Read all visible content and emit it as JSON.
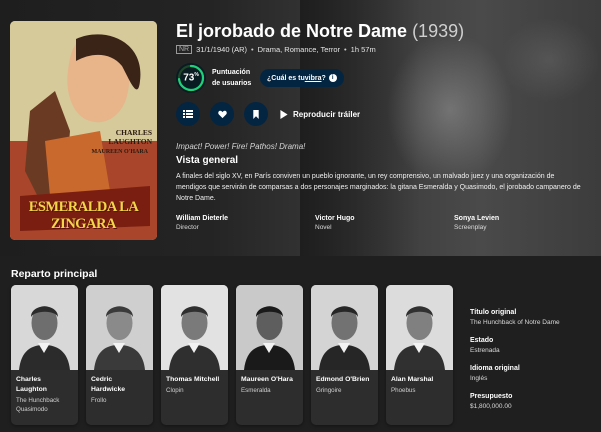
{
  "movie": {
    "title": "El jorobado de Notre Dame",
    "year": "(1939)",
    "certification": "NR",
    "release": "31/1/1940 (AR)",
    "genres": "Drama, Romance, Terror",
    "runtime": "1h 57m",
    "poster_lettering": "ESMERALDA LA ZINGARA",
    "poster_credit": "CHARLES LAUGHTON",
    "poster_costar": "MAUREEN O'HARA"
  },
  "score": {
    "value": "73",
    "unit": "%",
    "percent": 73,
    "label": "Puntuación de usuarios",
    "ring_color": "#21d07a",
    "track_color": "#204529"
  },
  "vibe": {
    "prefix": "¿Cuál es tu ",
    "link": "vibra",
    "suffix": "?"
  },
  "actions": {
    "list_icon": "list-icon",
    "favorite_icon": "heart-icon",
    "watchlist_icon": "bookmark-icon",
    "trailer_icon": "play-icon",
    "trailer_label": "Reproducir tráiler"
  },
  "tagline": "Impact! Power! Fire! Pathos! Drama!",
  "overview_heading": "Vista general",
  "overview": "A finales del siglo XV, en París conviven un pueblo ignorante, un rey comprensivo, un malvado juez y una organización de mendigos que servirán de comparsas a dos personajes marginados: la gitana Esmeralda y Quasimodo, el jorobado campanero de Notre Dame.",
  "crew": [
    {
      "name": "William Dieterle",
      "job": "Director"
    },
    {
      "name": "Victor Hugo",
      "job": "Novel"
    },
    {
      "name": "Sonya Levien",
      "job": "Screenplay"
    }
  ],
  "cast_heading": "Reparto principal",
  "cast": [
    {
      "name": "Charles Laughton",
      "character": "The Hunchback Quasimodo"
    },
    {
      "name": "Cedric Hardwicke",
      "character": "Frollo"
    },
    {
      "name": "Thomas Mitchell",
      "character": "Clopin"
    },
    {
      "name": "Maureen O'Hara",
      "character": "Esmeralda"
    },
    {
      "name": "Edmond O'Brien",
      "character": "Gringoire"
    },
    {
      "name": "Alan Marshal",
      "character": "Phoebus"
    }
  ],
  "facts": [
    {
      "label": "Título original",
      "value": "The Hunchback of Notre Dame"
    },
    {
      "label": "Estado",
      "value": "Estrenada"
    },
    {
      "label": "Idioma original",
      "value": "Inglés"
    },
    {
      "label": "Presupuesto",
      "value": "$1,800,000.00"
    }
  ]
}
